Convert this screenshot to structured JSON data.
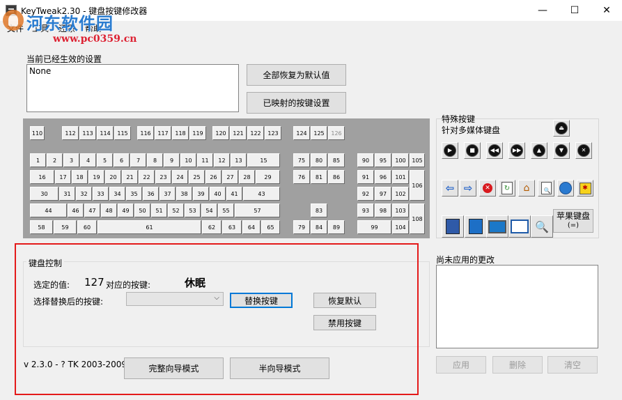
{
  "window": {
    "title": "KeyTweak2.30 - 键盘按键修改器",
    "minimize": "—",
    "maximize": "☐",
    "close": "✕"
  },
  "watermark": {
    "text": "河东软件园",
    "url": "www.pc0359.cn"
  },
  "menu": [
    "文件",
    "工具",
    "还原",
    "帮助"
  ],
  "current_settings": {
    "label": "当前已经生效的设置",
    "value": "None"
  },
  "buttons": {
    "restore_all": "全部恢复为默认值",
    "mapped_keys": "已映射的按键设置"
  },
  "keyboard": {
    "fkey_row": [
      "110",
      "112",
      "113",
      "114",
      "115",
      "116",
      "117",
      "118",
      "119",
      "120",
      "121",
      "122",
      "123",
      "124",
      "125",
      "126"
    ],
    "row1": [
      "1",
      "2",
      "3",
      "4",
      "5",
      "6",
      "7",
      "8",
      "9",
      "10",
      "11",
      "12",
      "13",
      "15"
    ],
    "row2": [
      "16",
      "17",
      "18",
      "19",
      "20",
      "21",
      "22",
      "23",
      "24",
      "25",
      "26",
      "27",
      "28",
      "29"
    ],
    "row3": [
      "30",
      "31",
      "32",
      "33",
      "34",
      "35",
      "36",
      "37",
      "38",
      "39",
      "40",
      "41",
      "43"
    ],
    "row4": [
      "44",
      "46",
      "47",
      "48",
      "49",
      "50",
      "51",
      "52",
      "53",
      "54",
      "55",
      "57"
    ],
    "row5": [
      "58",
      "59",
      "60",
      "61",
      "62",
      "63",
      "64",
      "65"
    ],
    "nav": [
      "75",
      "80",
      "85",
      "76",
      "81",
      "86",
      "83",
      "79",
      "84",
      "89"
    ],
    "numpad": [
      "90",
      "95",
      "100",
      "105",
      "91",
      "96",
      "101",
      "106",
      "92",
      "97",
      "102",
      "93",
      "98",
      "103",
      "108",
      "99",
      "104"
    ]
  },
  "special": {
    "title": "特殊按键",
    "subtitle": "针对多媒体键盘",
    "apple_label": "苹果键盘",
    "apple_sub": "(=)",
    "icons": [
      "eject-icon",
      "play-icon",
      "stop-icon",
      "rewind-icon",
      "fast-forward-icon",
      "volume-up-icon",
      "volume-down-icon",
      "mute-icon",
      "back-arrow-icon",
      "forward-arrow-icon",
      "stop-browser-icon",
      "refresh-icon",
      "home-icon",
      "search-doc-icon",
      "favorites-icon",
      "media-icon",
      "my-computer-icon",
      "network-icon",
      "monitor-icon",
      "calculator-icon",
      "magnifier-icon"
    ]
  },
  "control": {
    "group_title": "键盘控制",
    "selected_label": "选定的值:",
    "selected_value": "127",
    "mapped_label": "对应的按键:",
    "mapped_value": "休眠",
    "replace_label": "选择替换后的按键:",
    "replace_button": "替换按键",
    "restore_default": "恢复默认",
    "disable_key": "禁用按键"
  },
  "pending": {
    "label": "尚未应用的更改",
    "apply": "应用",
    "delete": "删除",
    "clear": "清空"
  },
  "footer": {
    "version": "v 2.3.0 - ? TK 2003-2009",
    "full_wizard": "完整向导模式",
    "half_wizard": "半向导模式"
  },
  "colors": {
    "accent": "#0078d7",
    "highlight_frame": "#e41a1a",
    "keyboard_bg": "#a0a0a0"
  }
}
